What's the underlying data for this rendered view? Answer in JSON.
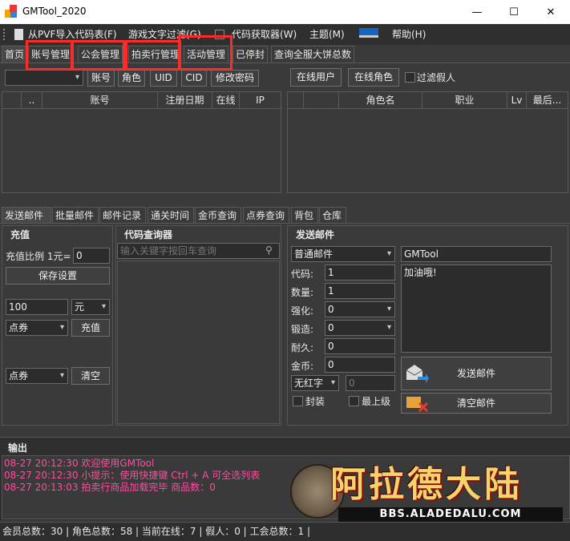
{
  "window": {
    "title": "GMTool_2020"
  },
  "menu": {
    "import": "从PVF导入代码表(F)",
    "text_filter": "游戏文字过滤(G)",
    "code_getter": "代码获取器(W)",
    "theme": "主题(M)",
    "help": "帮助(H)"
  },
  "tabs": [
    "首页",
    "账号管理",
    "公会管理",
    "拍卖行管理",
    "活动管理",
    "已停封",
    "查询全服大饼总数"
  ],
  "search": {
    "buttons": [
      "账号",
      "角色",
      "UID",
      "CID",
      "修改密码"
    ],
    "online_users": "在线用户",
    "online_roles": "在线角色",
    "filter_fake": "过滤假人"
  },
  "account_grid": {
    "columns": [
      "..",
      "账号",
      "注册日期",
      "在线",
      "IP"
    ]
  },
  "role_grid": {
    "columns": [
      "角色名",
      "职业",
      "Lv",
      "最后..."
    ]
  },
  "bottom_tabs": [
    "发送邮件",
    "批量邮件",
    "邮件记录",
    "通关时间",
    "金币查询",
    "点券查询",
    "背包",
    "仓库"
  ],
  "recharge": {
    "header": "充值",
    "ratio_label": "充值比例 1元=",
    "ratio_value": "0",
    "save": "保存设置",
    "amount": "100",
    "unit": "元",
    "type1": "点券",
    "recharge_btn": "充值",
    "type2": "点券",
    "clear_btn": "清空"
  },
  "code_lookup": {
    "header": "代码查询器",
    "placeholder": "输入关键字按回车查询"
  },
  "mail": {
    "header": "发送邮件",
    "mail_type": "普通邮件",
    "sender": "GMTool",
    "body": "加油哦!",
    "code_label": "代码:",
    "code": "1",
    "qty_label": "数量:",
    "qty": "1",
    "enhance_label": "强化:",
    "enhance": "0",
    "forge_label": "锻造:",
    "forge": "0",
    "durability_label": "耐久:",
    "durability": "0",
    "gold_label": "金币:",
    "gold": "0",
    "red_label": "无红字",
    "red_value": "0",
    "seal": "封装",
    "top_level": "最上级",
    "send": "发送邮件",
    "clear": "清空邮件"
  },
  "output": {
    "header": "输出",
    "lines": [
      "08-27 20:12:30 欢迎使用GMTool",
      "08-27 20:12:30 小提示：使用快捷键 Ctrl + A 可全选列表",
      "08-27 20:13:03 拍卖行商品加载完毕 商品数：0"
    ]
  },
  "logo": {
    "text": "阿拉德大陆",
    "url": "BBS.ALADEDALU.COM"
  },
  "status_bar": "会员总数：30 | 角色总数：58 | 当前在线：7 | 假人：0 | 工会总数：1 |"
}
